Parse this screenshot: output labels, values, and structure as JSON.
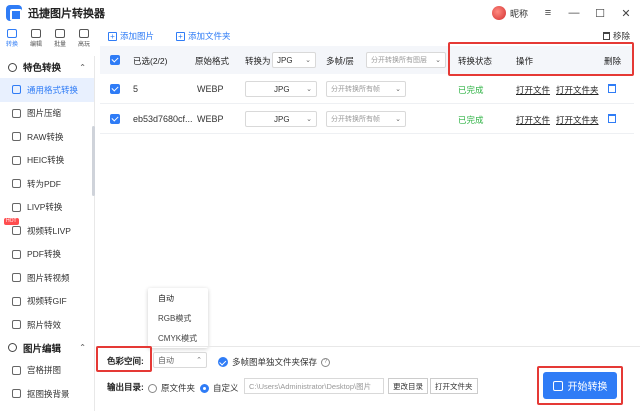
{
  "app": {
    "title": "迅捷图片转换器",
    "user": "昵称"
  },
  "rail": [
    {
      "label": "转换",
      "icon": "convert-icon"
    },
    {
      "label": "编辑",
      "icon": "edit-icon"
    },
    {
      "label": "批量",
      "icon": "batch-icon"
    },
    {
      "label": "高玩",
      "icon": "advanced-icon"
    }
  ],
  "sidebar": {
    "section1": "特色转换",
    "items": [
      {
        "label": "通用格式转换",
        "icon": "format-convert-icon",
        "active": true
      },
      {
        "label": "图片压缩",
        "icon": "compress-icon"
      },
      {
        "label": "RAW转换",
        "icon": "raw-icon"
      },
      {
        "label": "HEIC转换",
        "icon": "heic-icon"
      },
      {
        "label": "转为PDF",
        "icon": "pdf-icon"
      },
      {
        "label": "LIVP转换",
        "icon": "livp-icon"
      },
      {
        "label": "视频转LIVP",
        "icon": "video-livp-icon",
        "badge": "HOT"
      },
      {
        "label": "PDF转换",
        "icon": "pdf-convert-icon"
      },
      {
        "label": "图片转视频",
        "icon": "image-video-icon"
      },
      {
        "label": "视频转GIF",
        "icon": "video-gif-icon"
      },
      {
        "label": "照片特效",
        "icon": "photo-effect-icon"
      }
    ],
    "section2": "图片编辑",
    "items2": [
      {
        "label": "宫格拼图",
        "icon": "grid-collage-icon"
      },
      {
        "label": "抠图换背景",
        "icon": "cutout-icon"
      }
    ]
  },
  "toolbar": {
    "add_image": "添加图片",
    "add_folder": "添加文件夹",
    "remove": "移除"
  },
  "table": {
    "headers": {
      "selected": "已选(2/2)",
      "original_format": "原始格式",
      "convert_to": "转换为",
      "convert_to_value": "JPG",
      "frames": "多帧/层",
      "frames_value": "分开转换所有图层",
      "status": "转换状态",
      "action": "操作",
      "delete": "删除"
    },
    "rows": [
      {
        "name": "5",
        "format": "WEBP",
        "target": "JPG",
        "frames": "分开转换所有帧",
        "status": "已完成",
        "open_file": "打开文件",
        "open_folder": "打开文件夹"
      },
      {
        "name": "eb53d7680cf...",
        "format": "WEBP",
        "target": "JPG",
        "frames": "分开转换所有帧",
        "status": "已完成",
        "open_file": "打开文件",
        "open_folder": "打开文件夹"
      }
    ]
  },
  "bottom": {
    "color_space_label": "色彩空间:",
    "color_space_value": "自动",
    "color_options": [
      "自动",
      "RGB模式",
      "CMYK模式"
    ],
    "multi_frame_label": "多帧图单独文件夹保存",
    "output_label": "输出目录:",
    "original_folder": "原文件夹",
    "custom": "自定义",
    "path": "C:\\Users\\Administrator\\Desktop\\图片",
    "change_dir": "更改目录",
    "open_folder": "打开文件夹",
    "start": "开始转换"
  },
  "colors": {
    "accent": "#2f7cf6",
    "success": "#2fb344",
    "highlight": "#e53935"
  }
}
